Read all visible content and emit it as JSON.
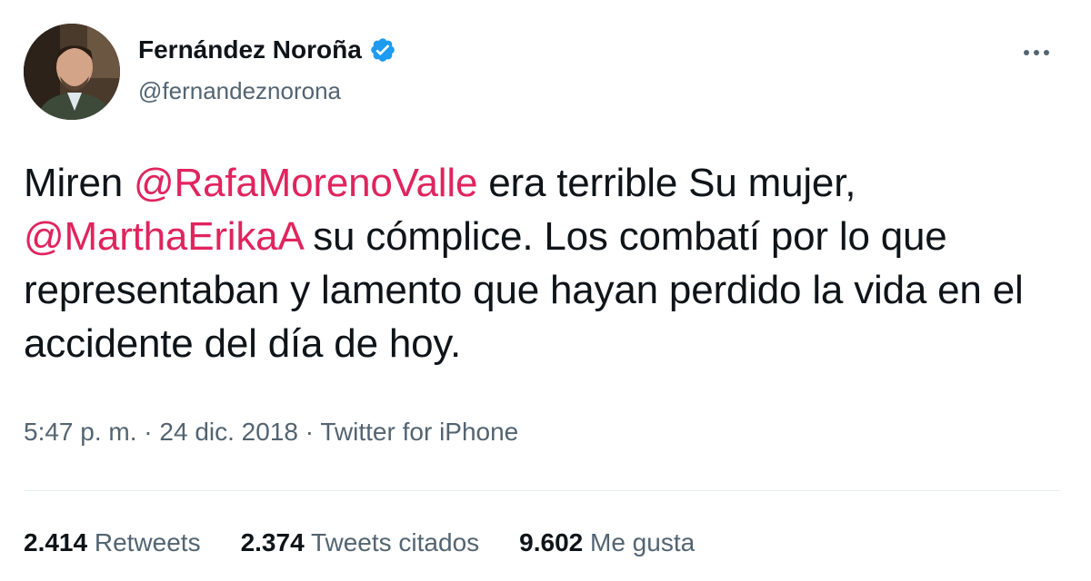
{
  "author": {
    "display_name": "Fernández Noroña",
    "handle": "@fernandeznorona",
    "verified_icon": "verified-badge-icon",
    "verified_color": "#1d9bf0"
  },
  "menu": {
    "more_icon": "more-horizontal-icon"
  },
  "tweet": {
    "segments": [
      {
        "text": "Miren ",
        "type": "text"
      },
      {
        "text": "@RafaMorenoValle",
        "type": "mention"
      },
      {
        "text": " era terrible Su mujer, ",
        "type": "text"
      },
      {
        "text": "@MarthaErikaA",
        "type": "mention"
      },
      {
        "text": " su cómplice. Los combatí por lo que representaban y lamento que hayan perdido la vida en el accidente del día de hoy.",
        "type": "text"
      }
    ],
    "mention_color": "#e0245e"
  },
  "meta": {
    "time": "5:47 p. m.",
    "separator1": " · ",
    "date": "24 dic. 2018",
    "separator2": " · ",
    "source": "Twitter for iPhone"
  },
  "stats": {
    "retweets_count": "2.414",
    "retweets_label": "Retweets",
    "quotes_count": "2.374",
    "quotes_label": "Tweets citados",
    "likes_count": "9.602",
    "likes_label": "Me gusta"
  }
}
